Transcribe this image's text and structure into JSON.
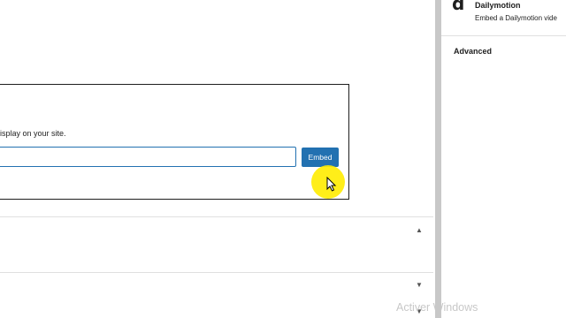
{
  "embed": {
    "instructions": "isplay on your site.",
    "url_value": "",
    "embed_button_label": "Embed"
  },
  "panels": {
    "collapse_icon": "▲",
    "expand_icon": "▼"
  },
  "sidebar": {
    "block_icon": "d",
    "block_title": "Dailymotion",
    "block_description": "Embed a Dailymotion vide",
    "advanced_label": "Advanced"
  },
  "watermark": "Activer Windows",
  "colors": {
    "accent": "#2271b1",
    "cursor_highlight": "#ffec00"
  }
}
